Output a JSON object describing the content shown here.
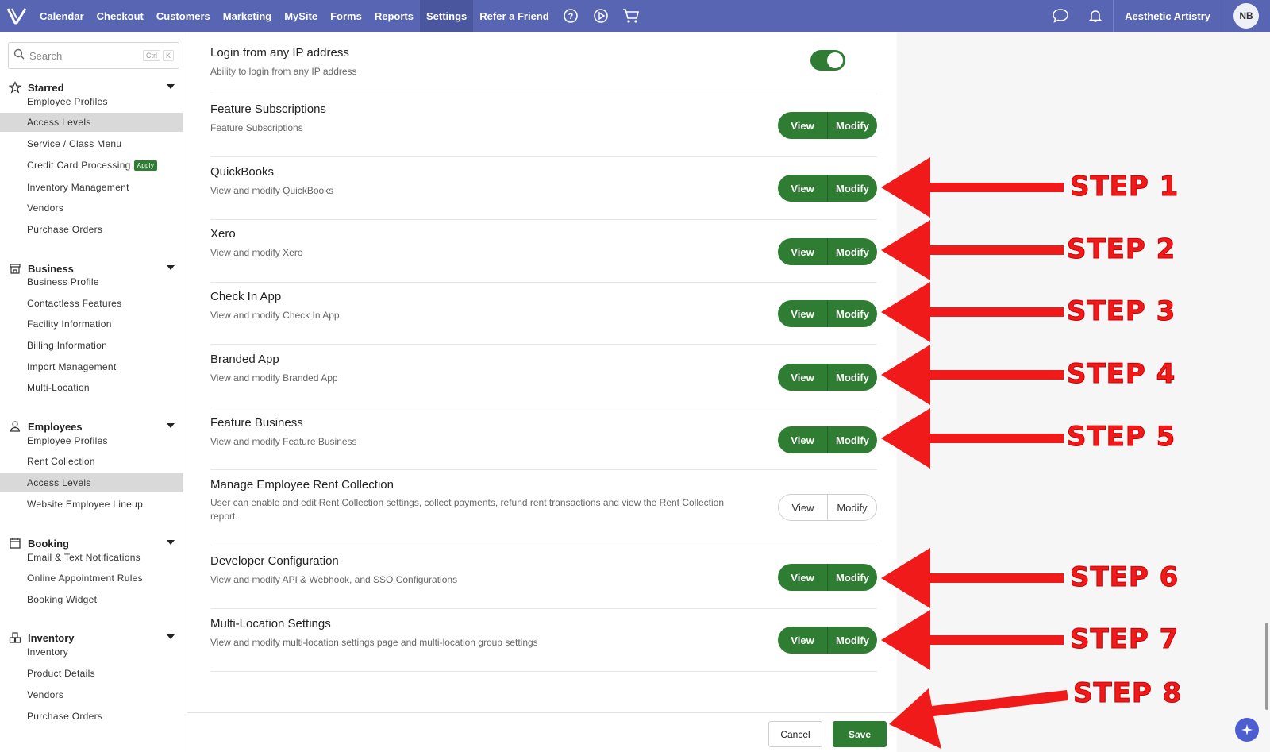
{
  "nav": {
    "items": [
      {
        "label": "Calendar",
        "active": false
      },
      {
        "label": "Checkout",
        "active": false
      },
      {
        "label": "Customers",
        "active": false
      },
      {
        "label": "Marketing",
        "active": false
      },
      {
        "label": "MySite",
        "active": false
      },
      {
        "label": "Forms",
        "active": false
      },
      {
        "label": "Reports",
        "active": false
      },
      {
        "label": "Settings",
        "active": true
      },
      {
        "label": "Refer a Friend",
        "active": false
      }
    ],
    "business_name": "Aesthetic Artistry",
    "avatar_initials": "NB"
  },
  "sidebar": {
    "search_placeholder": "Search",
    "shortcut_keys": [
      "Ctrl",
      "K"
    ],
    "sections": [
      {
        "title": "Starred",
        "icon": "star-icon",
        "items": [
          {
            "label": "Employee Profiles",
            "selected": false
          },
          {
            "label": "Access Levels",
            "selected": true
          },
          {
            "label": "Service / Class Menu",
            "selected": false
          },
          {
            "label": "Credit Card Processing",
            "selected": false,
            "badge": "Apply"
          },
          {
            "label": "Inventory Management",
            "selected": false
          },
          {
            "label": "Vendors",
            "selected": false
          },
          {
            "label": "Purchase Orders",
            "selected": false
          }
        ]
      },
      {
        "title": "Business",
        "icon": "storefront-icon",
        "items": [
          {
            "label": "Business Profile",
            "selected": false
          },
          {
            "label": "Contactless Features",
            "selected": false
          },
          {
            "label": "Facility Information",
            "selected": false
          },
          {
            "label": "Billing Information",
            "selected": false
          },
          {
            "label": "Import Management",
            "selected": false
          },
          {
            "label": "Multi-Location",
            "selected": false
          }
        ]
      },
      {
        "title": "Employees",
        "icon": "person-icon",
        "items": [
          {
            "label": "Employee Profiles",
            "selected": false
          },
          {
            "label": "Rent Collection",
            "selected": false
          },
          {
            "label": "Access Levels",
            "selected": true
          },
          {
            "label": "Website Employee Lineup",
            "selected": false
          }
        ]
      },
      {
        "title": "Booking",
        "icon": "calendar-icon",
        "items": [
          {
            "label": "Email & Text Notifications",
            "selected": false
          },
          {
            "label": "Online Appointment Rules",
            "selected": false
          },
          {
            "label": "Booking Widget",
            "selected": false
          }
        ]
      },
      {
        "title": "Inventory",
        "icon": "boxes-icon",
        "items": [
          {
            "label": "Inventory",
            "selected": false
          },
          {
            "label": "Product Details",
            "selected": false
          },
          {
            "label": "Vendors",
            "selected": false
          },
          {
            "label": "Purchase Orders",
            "selected": false
          }
        ]
      }
    ]
  },
  "permissions": {
    "login_row": {
      "title": "Login from any IP address",
      "desc": "Ability to login from any IP address",
      "enabled": true
    },
    "rows": [
      {
        "title": "Feature Subscriptions",
        "desc": "Feature Subscriptions",
        "view": "View",
        "modify": "Modify",
        "on": true
      },
      {
        "title": "QuickBooks",
        "desc": "View and modify QuickBooks",
        "view": "View",
        "modify": "Modify",
        "on": true
      },
      {
        "title": "Xero",
        "desc": "View and modify Xero",
        "view": "View",
        "modify": "Modify",
        "on": true
      },
      {
        "title": "Check In App",
        "desc": "View and modify Check In App",
        "view": "View",
        "modify": "Modify",
        "on": true
      },
      {
        "title": "Branded App",
        "desc": "View and modify Branded App",
        "view": "View",
        "modify": "Modify",
        "on": true
      },
      {
        "title": "Feature Business",
        "desc": "View and modify Feature Business",
        "view": "View",
        "modify": "Modify",
        "on": true
      },
      {
        "title": "Manage Employee Rent Collection",
        "desc": "User can enable and edit Rent Collection settings, collect payments, refund rent transactions and view the Rent Collection report.",
        "view": "View",
        "modify": "Modify",
        "on": false
      },
      {
        "title": "Developer Configuration",
        "desc": "View and modify API & Webhook, and SSO Configurations",
        "view": "View",
        "modify": "Modify",
        "on": true
      },
      {
        "title": "Multi-Location Settings",
        "desc": "View and modify multi-location settings page and multi-location group settings",
        "view": "View",
        "modify": "Modify",
        "on": true
      }
    ]
  },
  "footer": {
    "cancel_label": "Cancel",
    "save_label": "Save"
  },
  "annotations": {
    "steps": [
      "STEP 1",
      "STEP 2",
      "STEP 3",
      "STEP 4",
      "STEP 5",
      "STEP 6",
      "STEP 7",
      "STEP 8"
    ],
    "arrow_color": "#f01a1a"
  },
  "colors": {
    "nav": "#5765b3",
    "primary_green": "#2e7d32"
  }
}
